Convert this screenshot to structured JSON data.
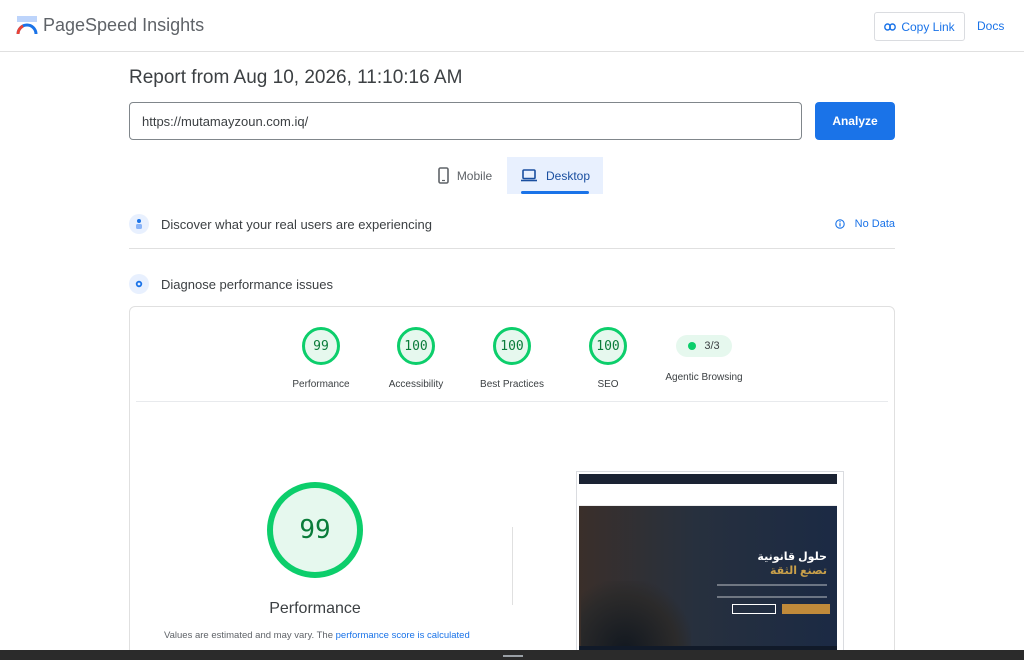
{
  "header": {
    "app_title": "PageSpeed Insights",
    "copy_link_label": "Copy Link",
    "docs_label": "Docs"
  },
  "report": {
    "title": "Report from Aug 10, 2026, 11:10:16 AM",
    "url_value": "https://mutamayzoun.com.iq/",
    "analyze_label": "Analyze"
  },
  "tabs": [
    {
      "label": "Mobile",
      "icon": "phone-icon",
      "selected": false
    },
    {
      "label": "Desktop",
      "icon": "laptop-icon",
      "selected": true
    }
  ],
  "field_data": {
    "heading": "Discover what your real users are experiencing",
    "status": "No Data"
  },
  "diagnose": {
    "heading": "Diagnose performance issues"
  },
  "scores": [
    {
      "label": "Performance",
      "value": "99"
    },
    {
      "label": "Accessibility",
      "value": "100"
    },
    {
      "label": "Best Practices",
      "value": "100"
    },
    {
      "label": "SEO",
      "value": "100"
    }
  ],
  "agentic": {
    "label": "Agentic Browsing",
    "value": "3/3"
  },
  "performance_detail": {
    "score": "99",
    "label": "Performance",
    "note_prefix": "Values are estimated and may vary. The ",
    "note_link": "performance score is calculated"
  },
  "thumbnail": {
    "hero_line1": "حلول قانونية",
    "hero_line2": "تصنع الثقة"
  },
  "colors": {
    "accent": "#1a73e8",
    "pass_green": "#0cce6b",
    "pass_bg": "#e6f8ee"
  }
}
